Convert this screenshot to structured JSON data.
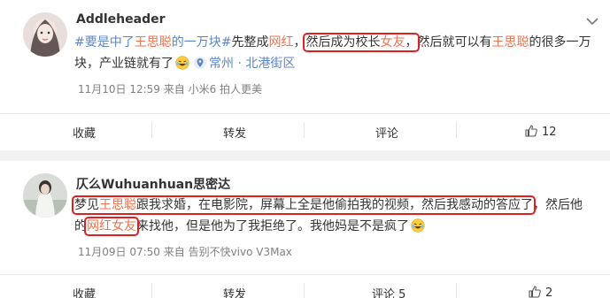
{
  "posts": [
    {
      "username": "Addleheader",
      "text": {
        "line1_topic": "#要是中了",
        "line1_link1": "王思聪",
        "line1_topic2": "的一万块#",
        "line1_a": "先整成",
        "line1_link2": "网红",
        "line1_b": "，",
        "line1_hl_a": "然后成为校长",
        "line1_hl_link": "女友",
        "line1_hl_b": "，",
        "line1_c": "然后就可以有",
        "line1_link3": "王思聪",
        "line1_d": "的很多一万",
        "line2_a": "块，产业链就有了",
        "location": "常州 · 北港街区"
      },
      "meta": "11月10日 12:59 来自 小米6 拍人更美",
      "actions": {
        "collect": "收藏",
        "repost": "转发",
        "comment": "评论",
        "likes": "12"
      }
    },
    {
      "username": "仄么Wuhuanhuan思密达",
      "text": {
        "line1_hl_a": "梦见",
        "line1_hl_link": "王思聪",
        "line1_hl_b": "跟我求婚，在电影院，屏幕上全是他偷拍我的视频，然后我感动的答应了",
        "line1_c": "，然后他",
        "line2_a": "的",
        "line2_hl_link": "网红女友",
        "line2_b": "来找他，但是他为了我拒绝了。我他妈是不是疯了"
      },
      "meta": "11月09日 07:50 来自 告别不快vivo V3Max",
      "actions": {
        "collect": "收藏",
        "repost": "转发",
        "comment": "评论 5",
        "likes": "2"
      }
    }
  ],
  "colors": {
    "link": "#eb7350",
    "topic": "#5d86c4",
    "highlight": "#e02020"
  },
  "icons": {
    "emoji": "laughing-emoji-icon",
    "location": "map-pin-icon",
    "like": "thumbs-up-icon",
    "chevron": "chevron-down-icon"
  }
}
